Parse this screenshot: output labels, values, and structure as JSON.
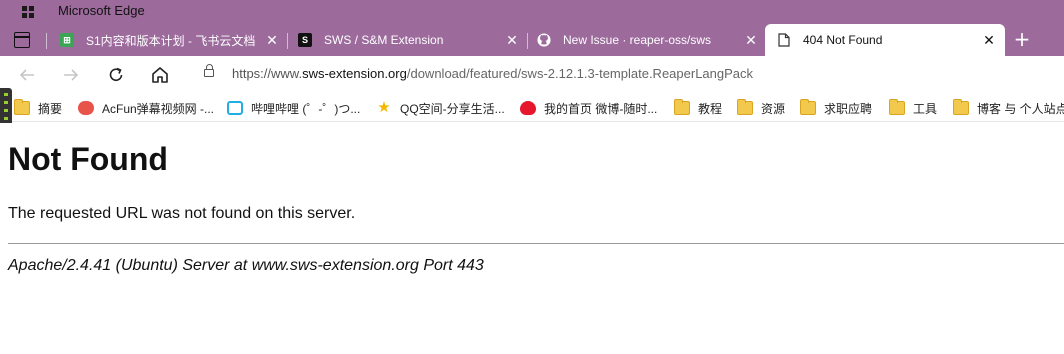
{
  "window": {
    "app_title": "Microsoft Edge"
  },
  "tabs": [
    {
      "label": "S1内容和版本计划 - 飞书云文档",
      "favicon": "feishu-doc-icon",
      "close": "✕"
    },
    {
      "label": "SWS / S&M Extension",
      "favicon": "sws-logo-icon",
      "close": "✕"
    },
    {
      "label": "New Issue · reaper-oss/sws",
      "favicon": "github-icon",
      "close": "✕"
    },
    {
      "label": "404 Not Found",
      "favicon": "page-icon",
      "close": "✕",
      "active": true
    }
  ],
  "new_tab": "+",
  "address": {
    "host": "https://www.",
    "domain": "sws-extension.org",
    "path": "/download/featured/sws-2.12.1.3-template.ReaperLangPack"
  },
  "bookmarks": [
    {
      "label": "摘要",
      "icon": "folder-icon"
    },
    {
      "label": "AcFun弹幕视频网 -...",
      "icon": "acfun-icon"
    },
    {
      "label": "哔哩哔哩 (゜-゜)つ...",
      "icon": "bilibili-icon"
    },
    {
      "label": "QQ空间-分享生活...",
      "icon": "qzone-star-icon"
    },
    {
      "label": "我的首页 微博-随时...",
      "icon": "weibo-icon"
    },
    {
      "label": "教程",
      "icon": "folder-icon"
    },
    {
      "label": "资源",
      "icon": "folder-icon"
    },
    {
      "label": "求职应聘",
      "icon": "folder-icon"
    },
    {
      "label": "工具",
      "icon": "folder-icon"
    },
    {
      "label": "博客 与 个人站点",
      "icon": "folder-icon"
    }
  ],
  "page": {
    "heading": "Not Found",
    "message": "The requested URL was not found on this server.",
    "server_signature": "Apache/2.4.41 (Ubuntu) Server at www.sws-extension.org Port 443"
  },
  "colors": {
    "frame": "#9c6b9c",
    "active_tab": "#ffffff",
    "folder": "#f2c94c"
  }
}
